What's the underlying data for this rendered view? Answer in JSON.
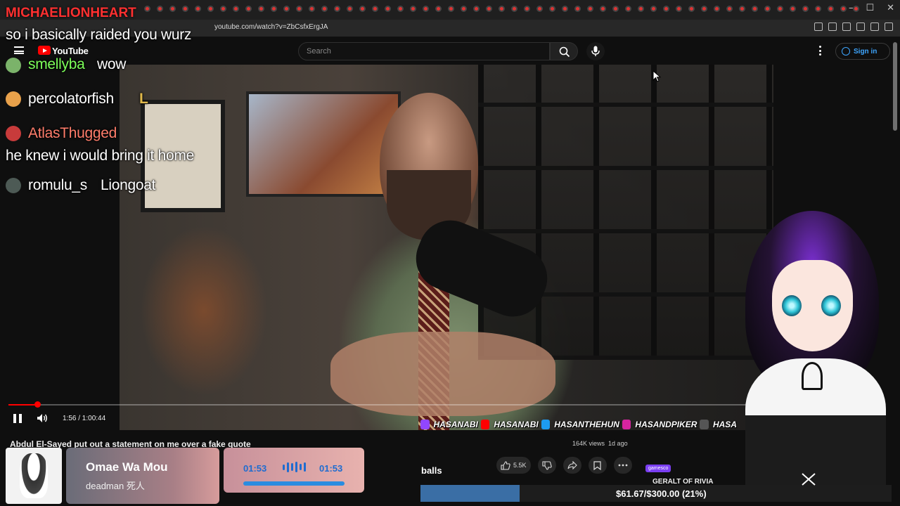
{
  "browser": {
    "url": "youtube.com/watch?v=ZbCsfxErgJA",
    "window_controls": [
      "–",
      "☐",
      "✕"
    ]
  },
  "youtube": {
    "logo_text": "YouTube",
    "search_placeholder": "Search",
    "sign_in_label": "Sign in"
  },
  "chat": {
    "top_name": "MICHAELIONHEART",
    "messages": [
      {
        "user": "",
        "text": "so i basically raided you wurz"
      },
      {
        "user": "smellyba",
        "text": "wow"
      },
      {
        "user": "percolatorfish",
        "text": "L"
      },
      {
        "user": "AtlasThugged",
        "text": "he knew i would bring it home"
      },
      {
        "user": "romulu_s",
        "text": "Liongoat"
      }
    ]
  },
  "player": {
    "time": "1:56 / 1:00:44",
    "progress_fraction": 0.0032
  },
  "socials": [
    "HASANABI",
    "HASANABI",
    "HASANTHEHUN",
    "HASANDPIKER",
    "HASA"
  ],
  "video": {
    "title": "Abdul El-Sayed put out a statement on me over a fake quote",
    "views": "164K views",
    "age": "1d ago",
    "likes": "5.5K"
  },
  "music": {
    "title": "Omae Wa Mou",
    "artist": "deadman 死人",
    "elapsed": "01:53",
    "duration": "01:53",
    "progress_fraction": 1.0
  },
  "overlay_text": {
    "balls": "balls",
    "ad_tag": "gamesco",
    "geralt": "GERALT OF RIVIA"
  },
  "donation": {
    "text": "$61.67/$300.00 (21%)",
    "fraction": 0.21
  },
  "colors": {
    "yt_red": "#ff0000",
    "link_blue": "#3ea6ff",
    "donation_fill": "#3a6ea5"
  }
}
